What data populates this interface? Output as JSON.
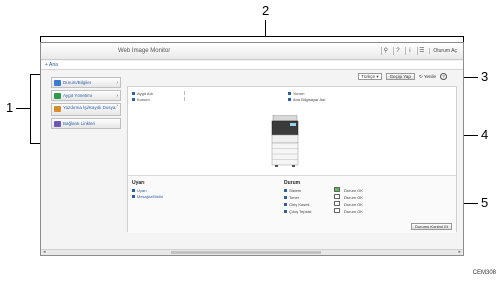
{
  "callouts": [
    "1",
    "2",
    "3",
    "4",
    "5"
  ],
  "header": {
    "title": "Web Image Monitor",
    "icons": [
      "search-icon",
      "help-icon",
      "info-icon",
      "log-icon"
    ],
    "logout_label": "Oturum Aç"
  },
  "homebar": {
    "home_label": "+ Ana"
  },
  "sidebar": {
    "items": [
      {
        "label": "Durum/Bilgiler",
        "icon_color": "#3a7bd5"
      },
      {
        "label": "Aygıt Yönetimi",
        "icon_color": "#2e9b4a"
      },
      {
        "label": "Yazdırma İşi/Kayıtlı Dosya",
        "icon_color": "#d98a2b"
      },
      {
        "label": "Bağlantı Linkleri",
        "icon_color": "#6f57b8"
      }
    ]
  },
  "toolbar": {
    "language_value": "Türkçe",
    "refresh_label": "Geçişi Yap",
    "refresh_link_label": "Yenile",
    "help_label": "?"
  },
  "device_info": {
    "left": [
      "Aygıt Adı",
      "Konum"
    ],
    "right": [
      "Yorum",
      "Ana Bilgisayar Adı"
    ]
  },
  "alerts": {
    "title": "Uyarı",
    "items": [
      "Uyarı",
      "Mesajlar/Bildiri"
    ]
  },
  "status": {
    "title": "Durum",
    "rows": [
      {
        "label": "Sistem",
        "value": "Durum OK"
      },
      {
        "label": "Toner",
        "value": "Durum OK"
      },
      {
        "label": "Giriş Kaseti",
        "value": "Durum OK"
      },
      {
        "label": "Çıkış Tepsisi",
        "value": "Durum OK"
      }
    ],
    "check_button": "Durumu Kontrol Et"
  },
  "figure_code": "CEM308"
}
